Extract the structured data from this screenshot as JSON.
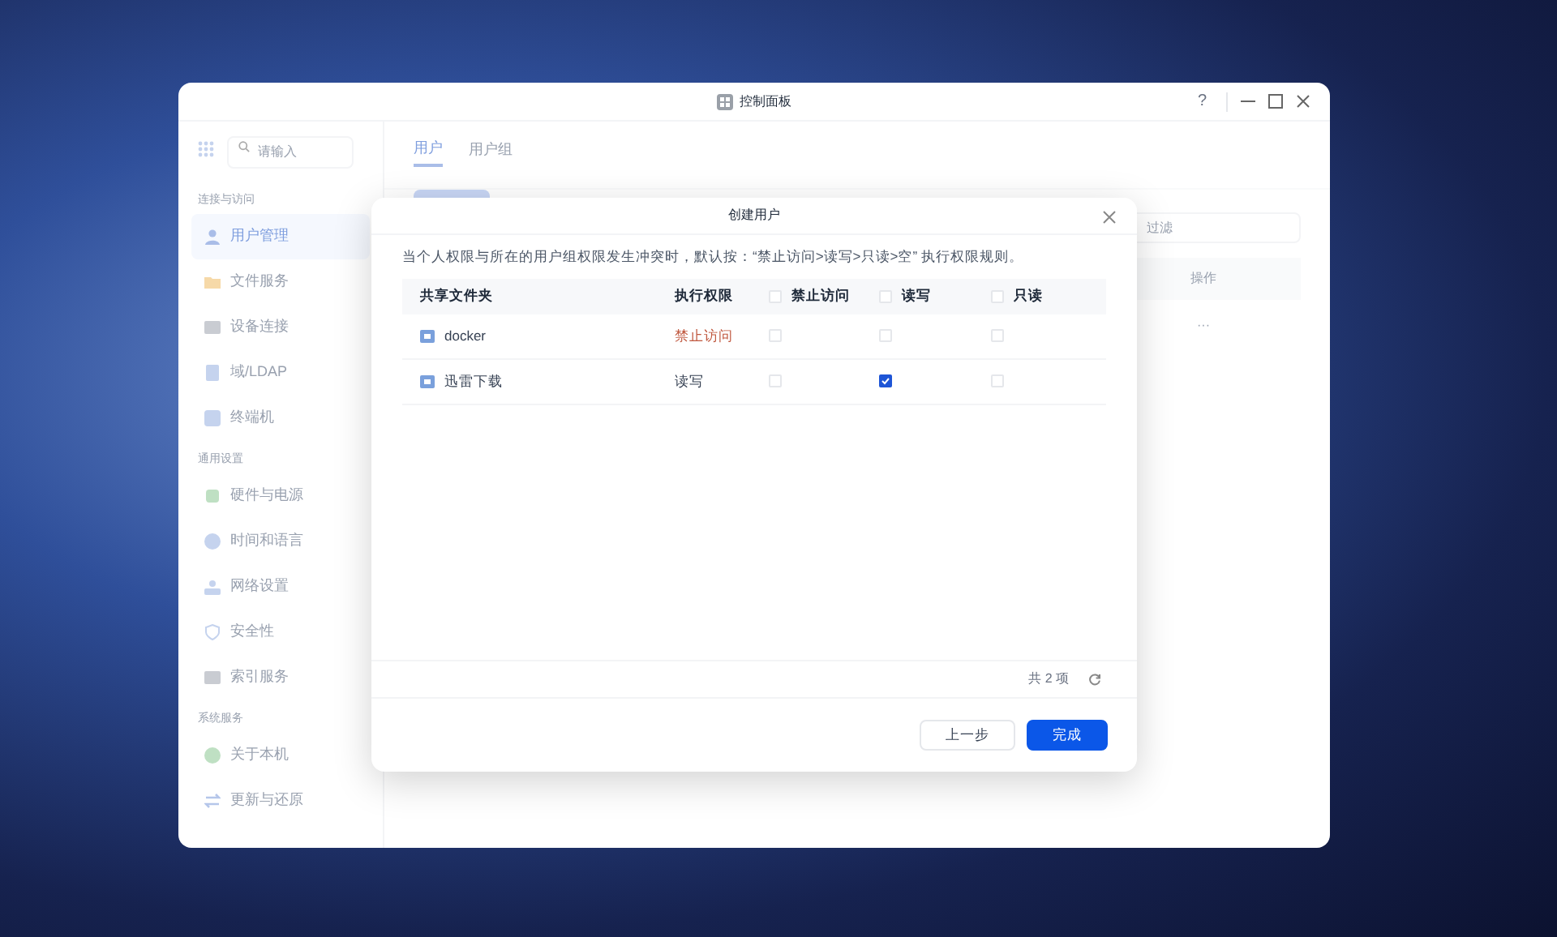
{
  "window": {
    "title": "控制面板",
    "help": "?"
  },
  "sidebar": {
    "search": {
      "placeholder": "请输入"
    },
    "sections": [
      {
        "title": "连接与访问",
        "items": [
          {
            "label": "用户管理",
            "selected": true
          },
          {
            "label": "文件服务",
            "selected": false
          },
          {
            "label": "设备连接",
            "selected": false
          },
          {
            "label": "域/LDAP",
            "selected": false
          },
          {
            "label": "终端机",
            "selected": false
          }
        ]
      },
      {
        "title": "通用设置",
        "items": [
          {
            "label": "硬件与电源",
            "selected": false
          },
          {
            "label": "时间和语言",
            "selected": false
          },
          {
            "label": "网络设置",
            "selected": false
          },
          {
            "label": "安全性",
            "selected": false
          },
          {
            "label": "索引服务",
            "selected": false
          }
        ]
      },
      {
        "title": "系统服务",
        "items": [
          {
            "label": "关于本机",
            "selected": false
          },
          {
            "label": "更新与还原",
            "selected": false
          }
        ]
      }
    ]
  },
  "tabs": [
    {
      "label": "用户",
      "selected": true
    },
    {
      "label": "用户组",
      "selected": false
    }
  ],
  "background_panel": {
    "filter": {
      "placeholder": "过滤"
    },
    "column": "操作",
    "row_action": "···"
  },
  "dialog": {
    "title": "创建用户",
    "note": "当个人权限与所在的用户组权限发生冲突时，默认按：“禁止访问>读写>只读>空” 执行权限规则。",
    "columns": [
      {
        "label": "共享文件夹"
      },
      {
        "label": "执行权限"
      },
      {
        "label": "禁止访问",
        "checked": false
      },
      {
        "label": "读写",
        "checked": false
      },
      {
        "label": "只读",
        "checked": false
      }
    ],
    "rows": [
      {
        "name": "docker",
        "permission": "禁止访问",
        "kind": "deny",
        "deny": false,
        "read_write": false,
        "read_only": false
      },
      {
        "name": "迅雷下载",
        "permission": "读写",
        "kind": "read_write",
        "deny": false,
        "read_write": true,
        "read_only": false
      }
    ],
    "count": "共 2 项",
    "buttons": [
      {
        "label": "上一步",
        "kind": "secondary"
      },
      {
        "label": "完成",
        "kind": "primary"
      }
    ]
  }
}
